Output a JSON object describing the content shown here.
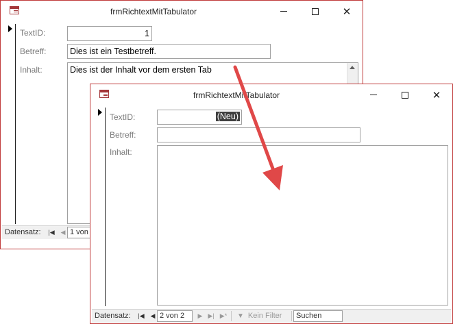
{
  "window_back": {
    "title": "frmRichtextMitTabulator",
    "fields": {
      "textid_label": "TextID:",
      "textid_value": "1",
      "betreff_label": "Betreff:",
      "betreff_value": "Dies ist ein Testbetreff.",
      "inhalt_label": "Inhalt:",
      "inhalt_value": "Dies ist der Inhalt vor dem ersten Tab"
    },
    "nav": {
      "label": "Datensatz:",
      "position": "1 von 2"
    }
  },
  "window_front": {
    "title": "frmRichtextMitTabulator",
    "fields": {
      "textid_label": "TextID:",
      "textid_value": "(Neu)",
      "betreff_label": "Betreff:",
      "betreff_value": "",
      "inhalt_label": "Inhalt:",
      "inhalt_value": ""
    },
    "nav": {
      "label": "Datensatz:",
      "position": "2 von 2",
      "filter": "Kein Filter",
      "search": "Suchen"
    }
  },
  "colors": {
    "window_border": "#c03a3a",
    "arrow": "#e04848",
    "neu_highlight": "#3f3f3f"
  },
  "icons": [
    "form-icon",
    "minimize-icon",
    "maximize-icon",
    "close-icon",
    "record-selector-arrow",
    "first-record-icon",
    "prev-record-icon",
    "next-record-icon",
    "last-record-icon",
    "new-record-icon",
    "filter-icon",
    "scroll-up-icon"
  ]
}
